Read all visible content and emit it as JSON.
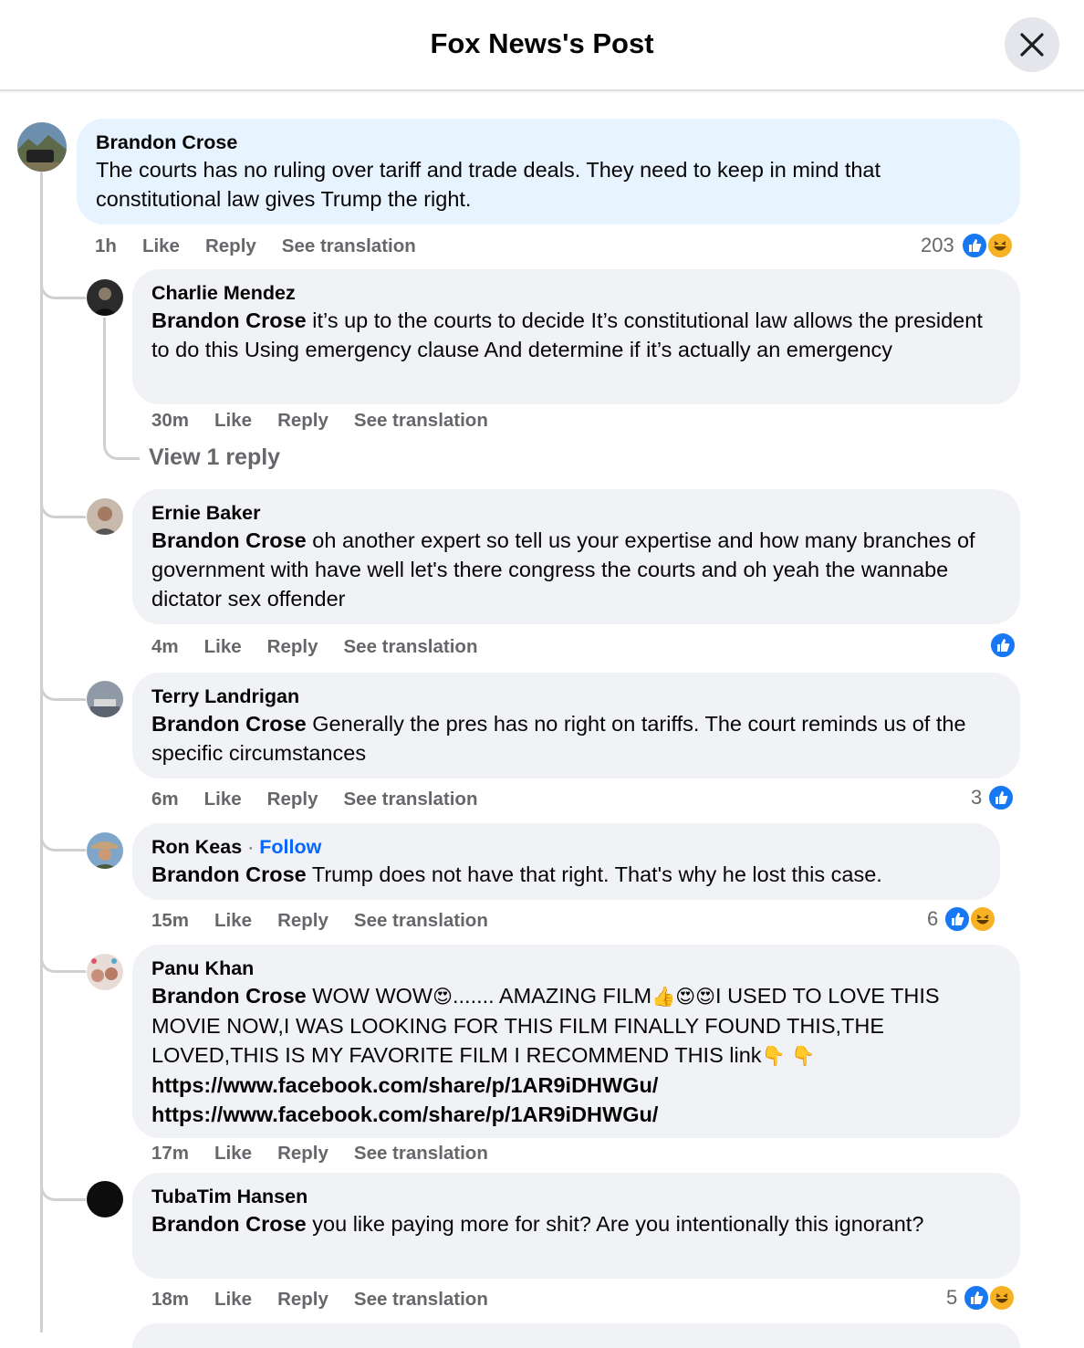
{
  "header": {
    "title": "Fox News's Post"
  },
  "comments": [
    {
      "author": "Brandon Crose",
      "text": "The courts has no ruling over tariff and trade deals. They need to keep in mind that constitutional law gives Trump the right.",
      "time": "1h",
      "like": "Like",
      "reply": "Reply",
      "translate": "See translation",
      "reaction_count": "203"
    },
    {
      "author": "Charlie Mendez",
      "mention": "Brandon Crose",
      "text": " it’s up to the courts to decide It’s constitutional law allows the president to do this Using emergency clause And determine if it’s actually an emergency",
      "time": "30m",
      "like": "Like",
      "reply": "Reply",
      "translate": "See translation",
      "view_replies": "View 1 reply"
    },
    {
      "author": "Ernie Baker",
      "mention": "Brandon Crose",
      "text": " oh another expert so tell us your expertise and how many branches of government with have well let's there congress the courts and oh yeah the wannabe dictator sex offender",
      "time": "4m",
      "like": "Like",
      "reply": "Reply",
      "translate": "See translation"
    },
    {
      "author": "Terry Landrigan",
      "mention": "Brandon Crose",
      "text": " Generally the pres has no right on tariffs. The court reminds us of the specific circumstances",
      "time": "6m",
      "like": "Like",
      "reply": "Reply",
      "translate": "See translation",
      "reaction_count": "3"
    },
    {
      "author": "Ron Keas",
      "follow": "Follow",
      "separator": " · ",
      "mention": "Brandon Crose",
      "text": " Trump does not have that right. That's why he lost this case.",
      "time": "15m",
      "like": "Like",
      "reply": "Reply",
      "translate": "See translation",
      "reaction_count": "6"
    },
    {
      "author": "Panu Khan",
      "mention": "Brandon Crose",
      "text_a": " WOW WOW",
      "text_b": "....... AMAZING FILM",
      "text_c": "I USED TO LOVE THIS MOVIE NOW,I WAS LOOKING FOR THIS FILM FINALLY FOUND THIS,THE LOVED,THIS IS MY FAVORITE FILM I RECOMMEND THIS link",
      "emoji_heart_eyes": "😍",
      "emoji_thumbs": "👍",
      "emoji_point": "👇",
      "link1": "https://www.facebook.com/share/p/1AR9iDHWGu/",
      "link2": "https://www.facebook.com/share/p/1AR9iDHWGu/",
      "time": "17m",
      "like": "Like",
      "reply": "Reply",
      "translate": "See translation"
    },
    {
      "author": "TubaTim Hansen",
      "mention": "Brandon Crose",
      "text": " you like paying more for shit? Are you intentionally this ignorant?",
      "time": "18m",
      "like": "Like",
      "reply": "Reply",
      "translate": "See translation",
      "reaction_count": "5"
    }
  ],
  "colors": {
    "like_blue": "#1877f2",
    "haha_yellow": "#f7b125",
    "follow_blue": "#0866ff",
    "highlight_bg": "#e7f3ff",
    "bubble_bg": "#f0f2f5"
  }
}
